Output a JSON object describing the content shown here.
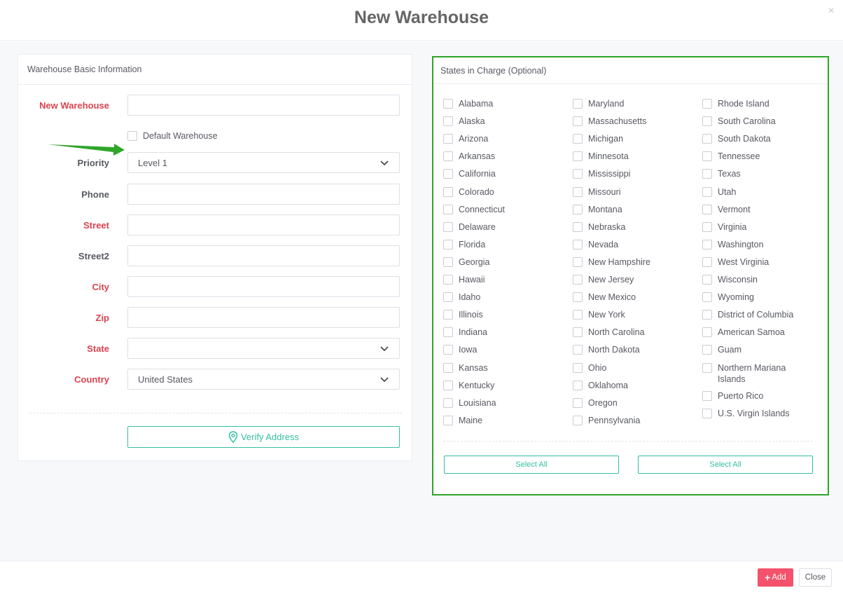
{
  "modal": {
    "title": "New Warehouse",
    "close_glyph": "×"
  },
  "left_panel": {
    "heading": "Warehouse Basic Information",
    "fields": {
      "warehouse_name": {
        "label": "New Warehouse",
        "value": ""
      },
      "default_warehouse": {
        "label": "Default Warehouse",
        "checked": false
      },
      "priority": {
        "label": "Priority",
        "value": "Level 1"
      },
      "phone": {
        "label": "Phone",
        "value": ""
      },
      "street": {
        "label": "Street",
        "value": ""
      },
      "street2": {
        "label": "Street2",
        "value": ""
      },
      "city": {
        "label": "City",
        "value": ""
      },
      "zip": {
        "label": "Zip",
        "value": ""
      },
      "state": {
        "label": "State",
        "value": ""
      },
      "country": {
        "label": "Country",
        "value": "United States"
      }
    },
    "verify_button": "Verify Address",
    "annotation_color": "#2fa52a"
  },
  "right_panel": {
    "heading": "States in Charge (Optional)",
    "columns": [
      [
        "Alabama",
        "Alaska",
        "Arizona",
        "Arkansas",
        "California",
        "Colorado",
        "Connecticut",
        "Delaware",
        "Florida",
        "Georgia",
        "Hawaii",
        "Idaho",
        "Illinois",
        "Indiana",
        "Iowa",
        "Kansas",
        "Kentucky",
        "Louisiana",
        "Maine"
      ],
      [
        "Maryland",
        "Massachusetts",
        "Michigan",
        "Minnesota",
        "Mississippi",
        "Missouri",
        "Montana",
        "Nebraska",
        "Nevada",
        "New Hampshire",
        "New Jersey",
        "New Mexico",
        "New York",
        "North Carolina",
        "North Dakota",
        "Ohio",
        "Oklahoma",
        "Oregon",
        "Pennsylvania"
      ],
      [
        "Rhode Island",
        "South Carolina",
        "South Dakota",
        "Tennessee",
        "Texas",
        "Utah",
        "Vermont",
        "Virginia",
        "Washington",
        "West Virginia",
        "Wisconsin",
        "Wyoming",
        "District of Columbia",
        "American Samoa",
        "Guam",
        "Northern Mariana Islands",
        "Puerto Rico",
        "U.S. Virgin Islands"
      ]
    ],
    "select_all_left": "Select All",
    "select_all_right": "Select All",
    "highlight_color": "#2fa52a"
  },
  "footer": {
    "add_label": "Add",
    "add_icon": "+",
    "close_label": "Close"
  },
  "colors": {
    "accent": "#34bfa3",
    "required": "#d9434f",
    "danger": "#f4516c"
  }
}
